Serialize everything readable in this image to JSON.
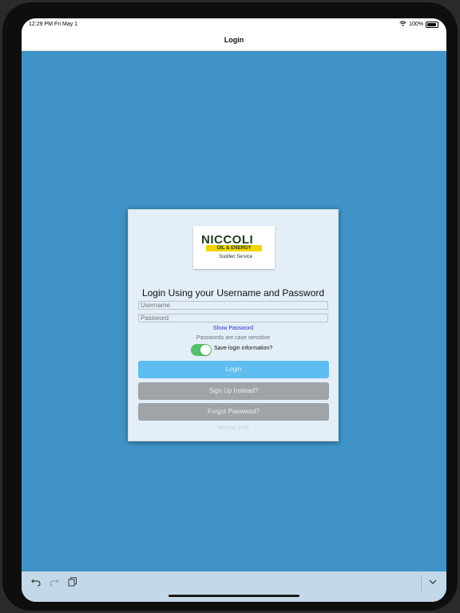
{
  "status": {
    "time": "12:29 PM   Fri May 1",
    "battery": "100%"
  },
  "nav": {
    "title": "Login"
  },
  "logo": {
    "name": "NICCOLI",
    "band": "OIL & ENERGY",
    "tagline": "Sudden Service"
  },
  "form": {
    "heading": "Login Using your Username and Password",
    "username_placeholder": "Username",
    "password_placeholder": "Password",
    "show_password": "Show Password",
    "case_hint": "Passwords are case sensitive",
    "save_login_label": "Save login information?",
    "save_login_on": true,
    "login_button": "Login",
    "signup_button": "Sign Up Instead?",
    "forgot_button": "Forgot Password?",
    "version": "Version 3.00"
  },
  "colors": {
    "background": "#3f93c6",
    "login_button": "#5fbdf1",
    "secondary_button": "#9ea4a8",
    "toggle_on": "#53c06a",
    "link": "#2430cc"
  },
  "icons": [
    "wifi-icon",
    "battery-icon",
    "undo-icon",
    "redo-icon",
    "copy-icon",
    "chevron-down-icon"
  ]
}
